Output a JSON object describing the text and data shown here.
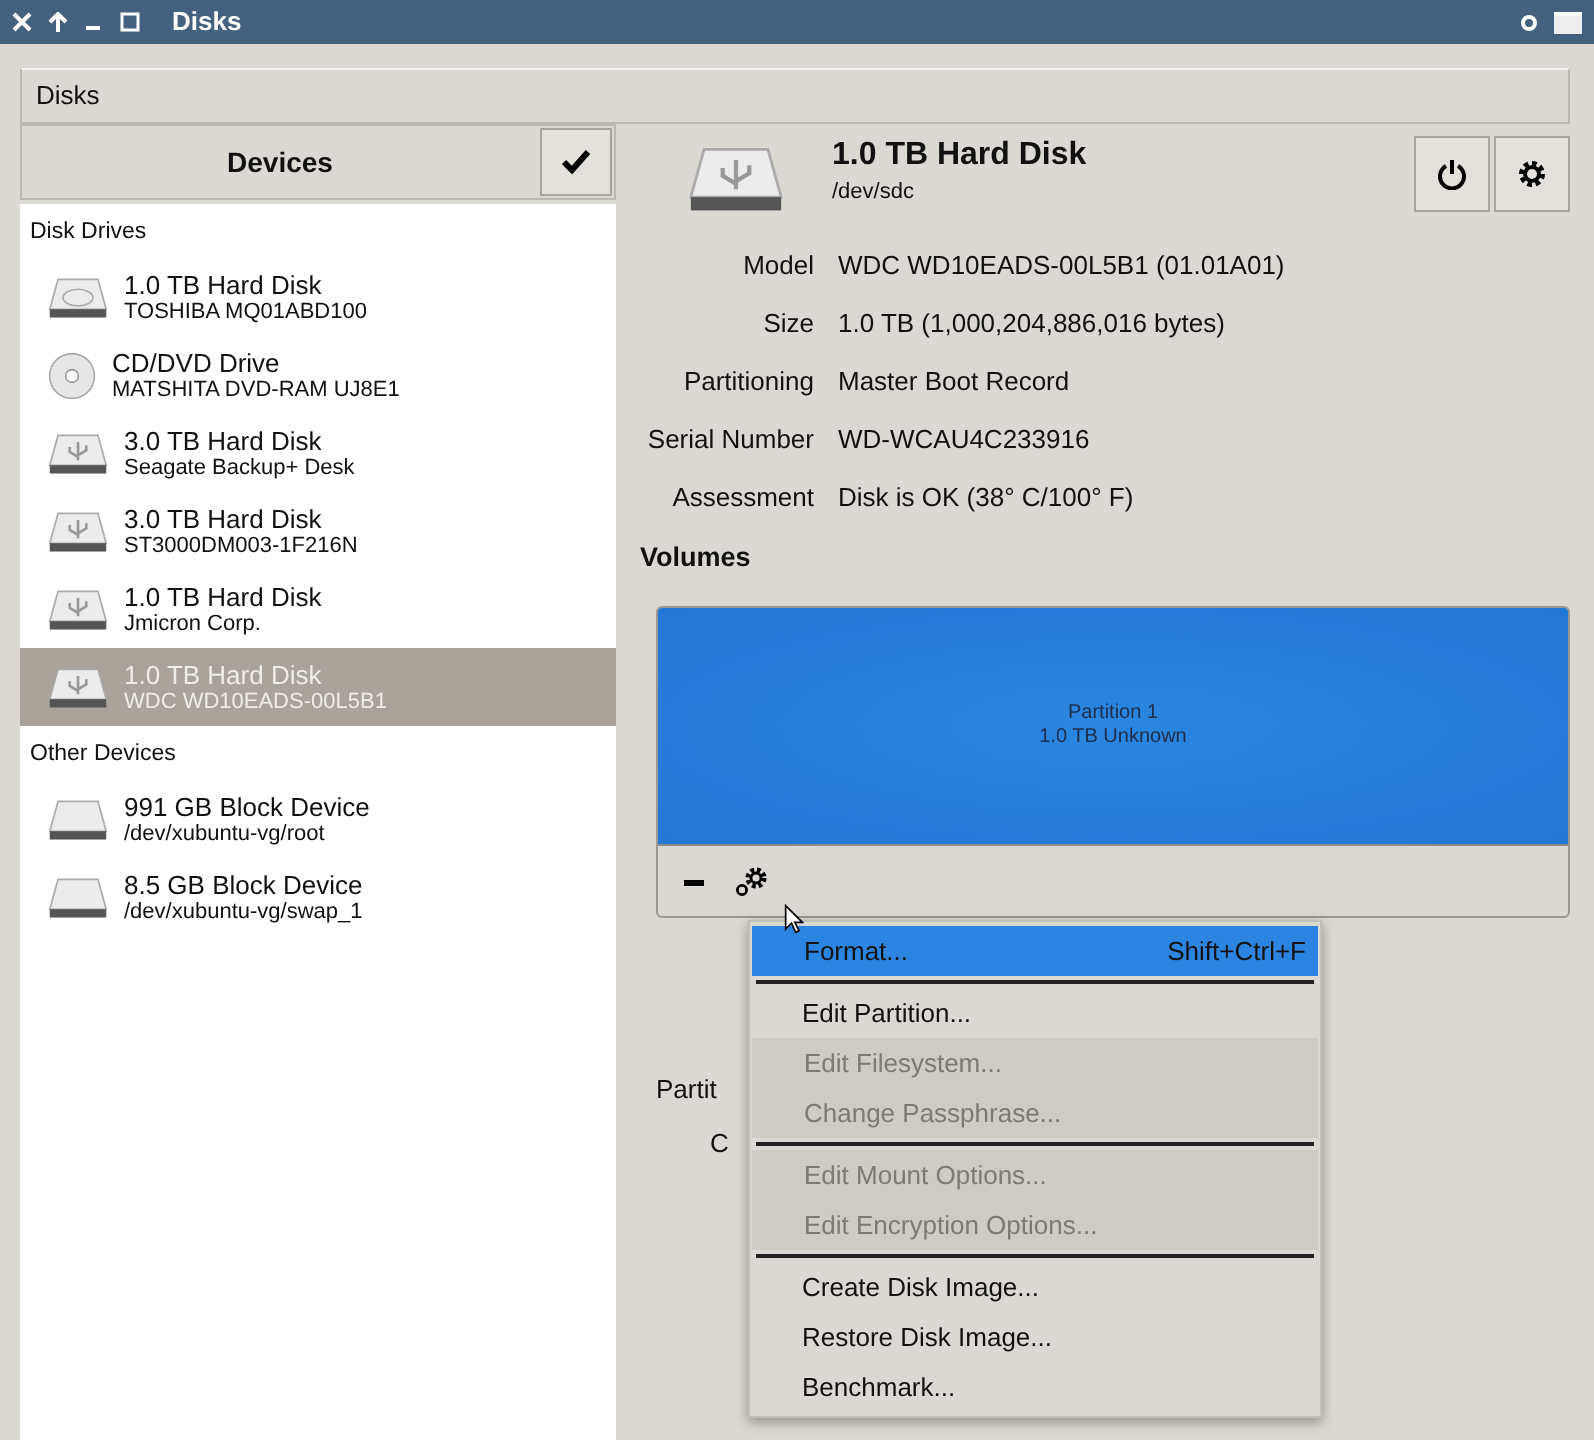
{
  "window": {
    "title": "Disks"
  },
  "header": {
    "title": "Disks"
  },
  "sidebar": {
    "title": "Devices",
    "sections": [
      {
        "title": "Disk Drives",
        "items": [
          {
            "kind": "hdd",
            "name": "1.0 TB Hard Disk",
            "detail": "TOSHIBA MQ01ABD100",
            "selected": false
          },
          {
            "kind": "optical",
            "name": "CD/DVD Drive",
            "detail": "MATSHITA DVD-RAM UJ8E1",
            "selected": false
          },
          {
            "kind": "usb",
            "name": "3.0 TB Hard Disk",
            "detail": "Seagate Backup+  Desk",
            "selected": false
          },
          {
            "kind": "usb",
            "name": "3.0 TB Hard Disk",
            "detail": "ST3000DM003-1F216N",
            "selected": false
          },
          {
            "kind": "usb",
            "name": "1.0 TB Hard Disk",
            "detail": "Jmicron Corp.",
            "selected": false
          },
          {
            "kind": "usb",
            "name": "1.0 TB Hard Disk",
            "detail": "WDC WD10EADS-00L5B1",
            "selected": true
          }
        ]
      },
      {
        "title": "Other Devices",
        "items": [
          {
            "kind": "block",
            "name": "991 GB Block Device",
            "detail": "/dev/xubuntu-vg/root",
            "selected": false
          },
          {
            "kind": "block",
            "name": "8.5 GB Block Device",
            "detail": "/dev/xubuntu-vg/swap_1",
            "selected": false
          }
        ]
      }
    ]
  },
  "disk": {
    "title": "1.0 TB Hard Disk",
    "device": "/dev/sdc",
    "properties": [
      {
        "label": "Model",
        "value": "WDC WD10EADS-00L5B1 (01.01A01)"
      },
      {
        "label": "Size",
        "value": "1.0 TB (1,000,204,886,016 bytes)"
      },
      {
        "label": "Partitioning",
        "value": "Master Boot Record"
      },
      {
        "label": "Serial Number",
        "value": "WD-WCAU4C233916"
      },
      {
        "label": "Assessment",
        "value": "Disk is OK (38° C/100° F)"
      }
    ]
  },
  "volumes": {
    "title": "Volumes",
    "partitions": [
      {
        "name": "Partition 1",
        "detail": "1.0 TB Unknown",
        "selected": true
      }
    ],
    "partial_labels": [
      "Partit",
      "C"
    ]
  },
  "context_menu": [
    {
      "kind": "item",
      "label": "Format...",
      "shortcut": "Shift+Ctrl+F",
      "selected": true,
      "disabled": false
    },
    {
      "kind": "separator"
    },
    {
      "kind": "item",
      "label": "Edit Partition...",
      "selected": false,
      "disabled": false
    },
    {
      "kind": "item",
      "label": "Edit Filesystem...",
      "selected": false,
      "disabled": true
    },
    {
      "kind": "item",
      "label": "Change Passphrase...",
      "selected": false,
      "disabled": true
    },
    {
      "kind": "separator"
    },
    {
      "kind": "item",
      "label": "Edit Mount Options...",
      "selected": false,
      "disabled": true
    },
    {
      "kind": "item",
      "label": "Edit Encryption Options...",
      "selected": false,
      "disabled": true
    },
    {
      "kind": "separator"
    },
    {
      "kind": "item",
      "label": "Create Disk Image...",
      "selected": false,
      "disabled": false
    },
    {
      "kind": "item",
      "label": "Restore Disk Image...",
      "selected": false,
      "disabled": false
    },
    {
      "kind": "item",
      "label": "Benchmark...",
      "selected": false,
      "disabled": false
    }
  ]
}
